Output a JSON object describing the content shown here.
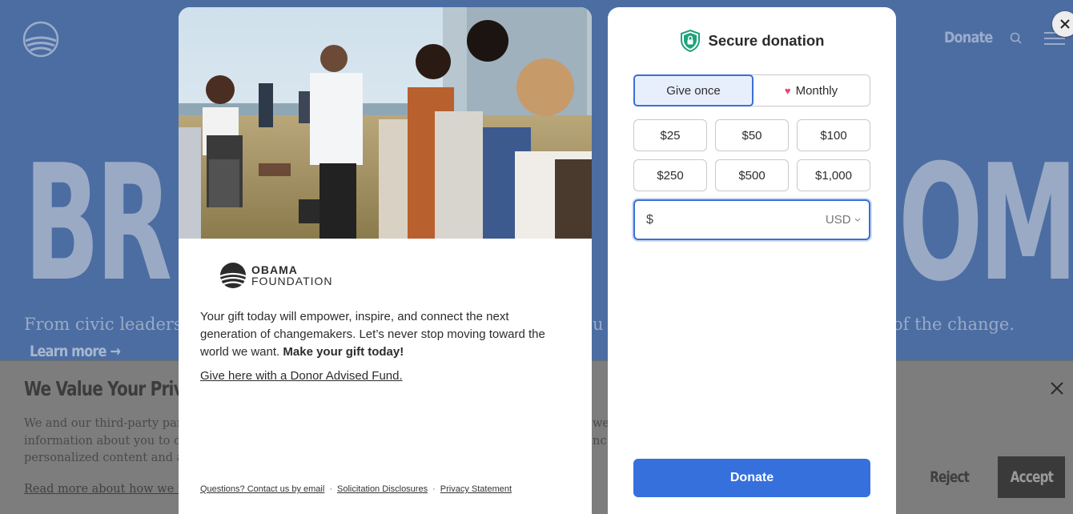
{
  "site": {
    "nav_donate": "Donate",
    "hero_left": "BR",
    "hero_right": "OME",
    "hero_sub_a": "From civic leaders",
    "hero_sub_b": "u",
    "hero_sub_c": "of the change.",
    "learn_more": "Learn more →"
  },
  "privacy": {
    "title": "We Value Your Privacy",
    "body_left": [
      "We and our third-party partr",
      "information about you to op",
      "personalized content and ad"
    ],
    "body_right": [
      "we",
      "nc",
      ""
    ],
    "read_more": "Read more about how we use",
    "reject": "Reject",
    "accept": "Accept"
  },
  "left_card": {
    "logo_line1": "OBAMA",
    "logo_line2": "FOUNDATION",
    "intro_text": "Your gift today will empower, inspire, and connect the next generation of changemakers. Let’s never stop moving toward the world we want.",
    "intro_bold": "Make your gift today!",
    "daf_link": "Give here with a Donor Advised Fund.",
    "footer": {
      "questions": "Questions? Contact us by email",
      "solicitation": "Solicitation Disclosures",
      "privacy": "Privacy Statement",
      "separator": "·"
    }
  },
  "right_card": {
    "title": "Secure donation",
    "frequency": {
      "once": "Give once",
      "monthly": "Monthly",
      "selected": "Give once"
    },
    "amounts": [
      "$25",
      "$50",
      "$100",
      "$250",
      "$500",
      "$1,000"
    ],
    "custom_amount": {
      "currency_symbol": "$",
      "value": "",
      "currency_code": "USD"
    },
    "donate_label": "Donate"
  },
  "colors": {
    "site_blue": "#4c6da2",
    "donate_blue": "#3570dd",
    "heart_pink": "#e8456f",
    "shield_green": "#1ea37a"
  }
}
